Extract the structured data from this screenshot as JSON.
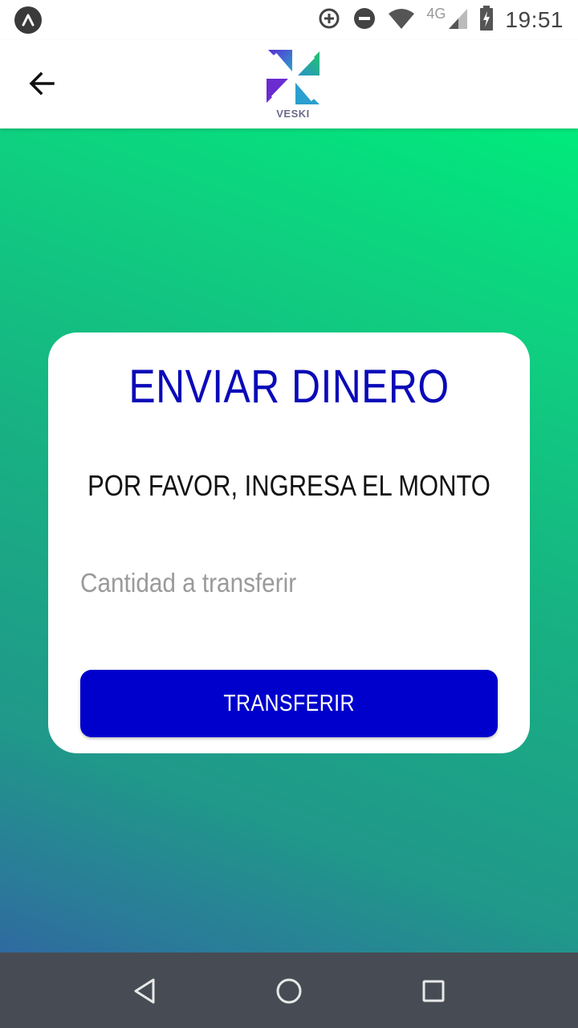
{
  "status_bar": {
    "time": "19:51",
    "network_type": "4G",
    "icons": [
      "app-notification-icon",
      "data-saver-icon",
      "do-not-disturb-icon",
      "wifi-icon",
      "cell-signal-icon",
      "battery-charging-icon"
    ]
  },
  "app_bar": {
    "back_icon": "arrow-left-icon",
    "logo_text": "VESKI"
  },
  "card": {
    "title": "ENVIAR DINERO",
    "subtitle": "POR FAVOR, INGRESA EL MONTO",
    "amount_input": {
      "value": "",
      "placeholder": "Cantidad a transferir"
    },
    "transfer_button_label": "TRANSFERIR"
  },
  "colors": {
    "gradient_top": "#00ea7c",
    "gradient_bottom": "#2f6aa0",
    "title": "#0a0ab8",
    "button": "#0000cc",
    "nav_bar": "#474c54"
  },
  "nav_bar": {
    "icons": [
      "back-triangle-icon",
      "home-circle-icon",
      "recents-square-icon"
    ]
  }
}
